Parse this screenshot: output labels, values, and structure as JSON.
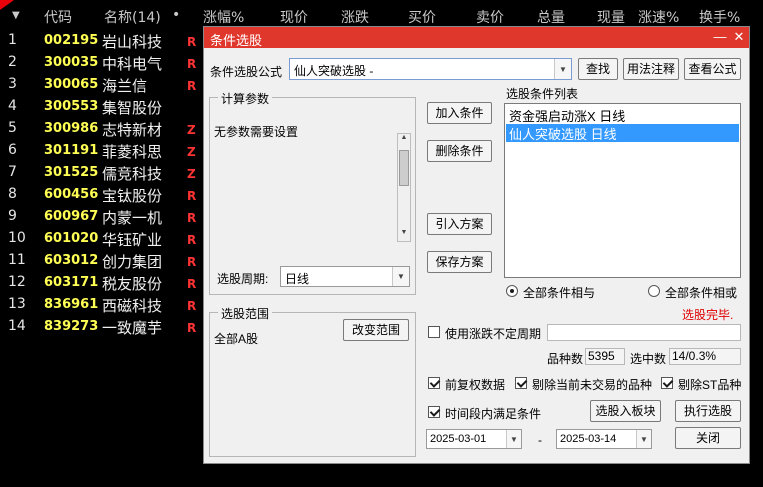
{
  "header": {
    "columns": [
      "代码",
      "名称(14)",
      "•",
      "涨幅%",
      "现价",
      "涨跌",
      "买价",
      "卖价",
      "总量",
      "现量",
      "涨速%",
      "换手%"
    ]
  },
  "stocks": [
    {
      "idx": "1",
      "code": "002195",
      "name": "岩山科技",
      "flag": "R"
    },
    {
      "idx": "2",
      "code": "300035",
      "name": "中科电气",
      "flag": "R"
    },
    {
      "idx": "3",
      "code": "300065",
      "name": "海兰信",
      "flag": "R"
    },
    {
      "idx": "4",
      "code": "300553",
      "name": "集智股份",
      "flag": ""
    },
    {
      "idx": "5",
      "code": "300986",
      "name": "志特新材",
      "flag": "Z"
    },
    {
      "idx": "6",
      "code": "301191",
      "name": "菲菱科思",
      "flag": "Z"
    },
    {
      "idx": "7",
      "code": "301525",
      "name": "儒竞科技",
      "flag": "Z"
    },
    {
      "idx": "8",
      "code": "600456",
      "name": "宝钛股份",
      "flag": "R"
    },
    {
      "idx": "9",
      "code": "600967",
      "name": "内蒙一机",
      "flag": "R"
    },
    {
      "idx": "10",
      "code": "601020",
      "name": "华钰矿业",
      "flag": "R"
    },
    {
      "idx": "11",
      "code": "603012",
      "name": "创力集团",
      "flag": "R"
    },
    {
      "idx": "12",
      "code": "603171",
      "name": "税友股份",
      "flag": "R"
    },
    {
      "idx": "13",
      "code": "836961",
      "name": "西磁科技",
      "flag": "R"
    },
    {
      "idx": "14",
      "code": "839273",
      "name": "一致魔芋",
      "flag": "R"
    }
  ],
  "dialog": {
    "title": "条件选股",
    "formula_label": "条件选股公式",
    "formula_value": "仙人突破选股 -",
    "find_btn": "查找",
    "usage_btn": "用法注释",
    "view_formula_btn": "查看公式",
    "calc_params_title": "计算参数",
    "no_params_text": "无参数需要设置",
    "period_label": "选股周期:",
    "period_value": "日线",
    "add_cond_btn": "加入条件",
    "del_cond_btn": "删除条件",
    "import_plan_btn": "引入方案",
    "save_plan_btn": "保存方案",
    "cond_list_title": "选股条件列表",
    "conditions": [
      "资金强启动涨X  日线",
      "仙人突破选股  日线"
    ],
    "radio_and": "全部条件相与",
    "radio_or": "全部条件相或",
    "status_text": "选股完毕.",
    "range_title": "选股范围",
    "range_value": "全部A股",
    "change_range_btn": "改变范围",
    "use_uncertain_period": "使用涨跌不定周期",
    "stock_count_label": "品种数",
    "stock_count_value": "5395",
    "selected_count_label": "选中数",
    "selected_count_value": "14/0.3%",
    "pre_adjust": "前复权数据",
    "exclude_untraded": "剔除当前未交易的品种",
    "exclude_st": "剔除ST品种",
    "time_range_satisfy": "时间段内满足条件",
    "select_to_block_btn": "选股入板块",
    "execute_btn": "执行选股",
    "date_from": "2025-03-01",
    "date_sep": "-",
    "date_to": "2025-03-14",
    "close_btn": "关闭"
  },
  "colors": {
    "code": "#ffff54",
    "flag": "#ff3333",
    "titlebar": "#e0372c",
    "selection": "#3399ff",
    "status": "#e00000"
  }
}
